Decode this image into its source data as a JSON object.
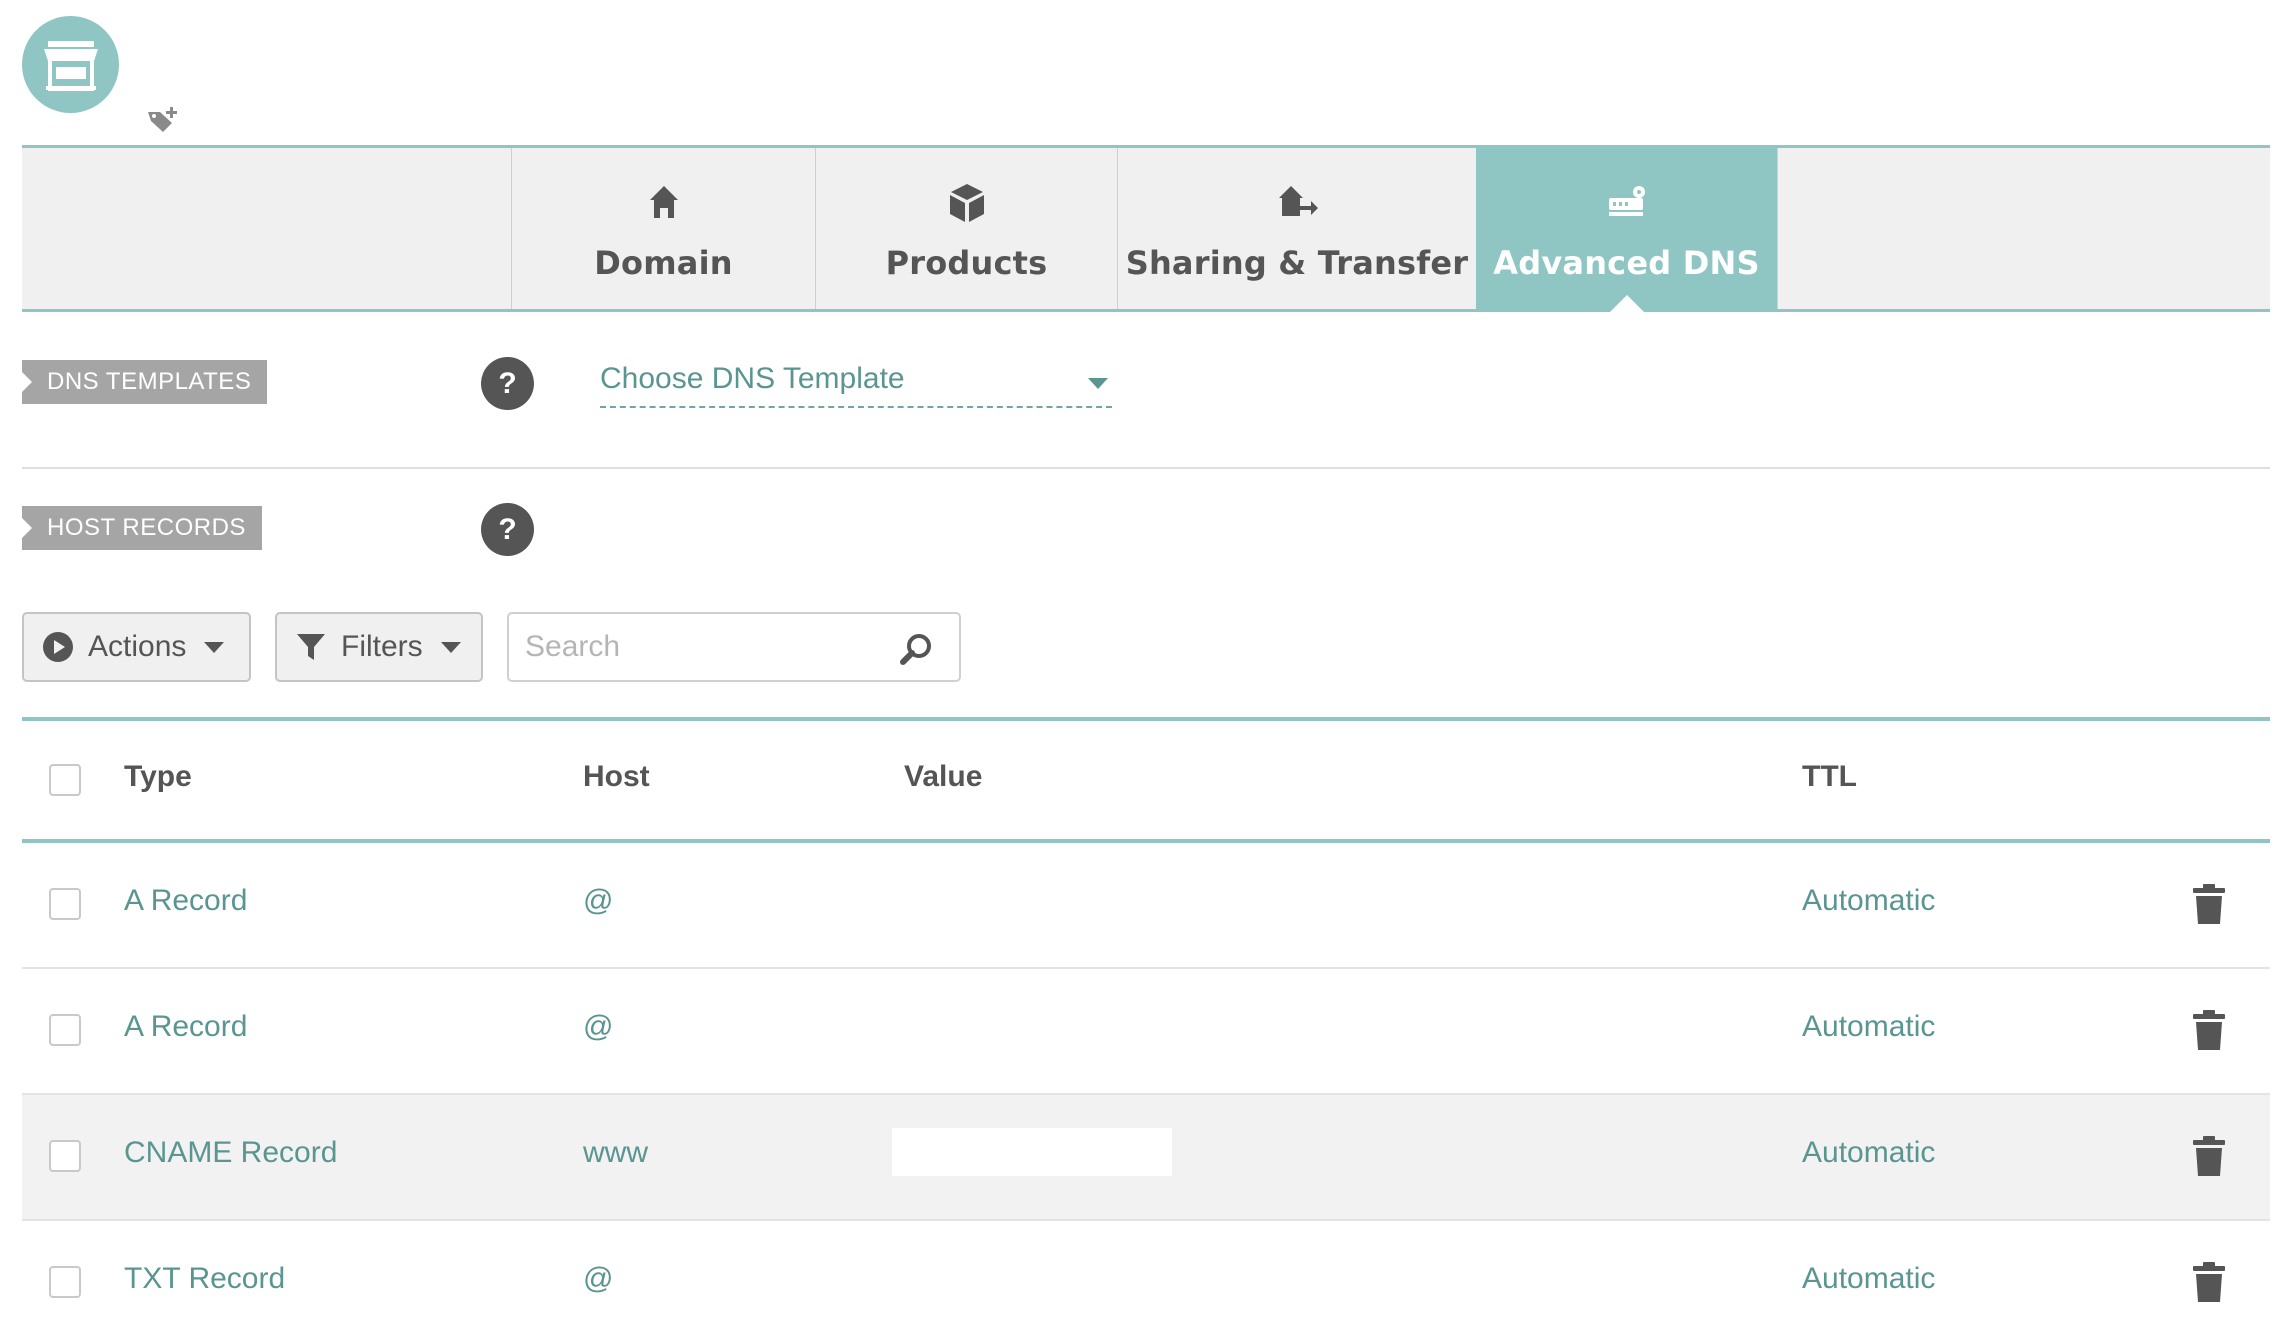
{
  "header": {
    "avatar_icon": "storefront-icon",
    "tag_icon": "tag-add-icon"
  },
  "tabs": [
    {
      "label": "Domain",
      "icon": "home-icon",
      "active": false
    },
    {
      "label": "Products",
      "icon": "box-icon",
      "active": false
    },
    {
      "label": "Sharing & Transfer",
      "icon": "house-transfer-icon",
      "active": false
    },
    {
      "label": "Advanced DNS",
      "icon": "router-icon",
      "active": true
    }
  ],
  "dns_templates": {
    "label": "DNS TEMPLATES",
    "help": "?",
    "select_value": "Choose DNS Template"
  },
  "host_records": {
    "label": "HOST RECORDS",
    "help": "?"
  },
  "toolbar": {
    "actions_label": "Actions",
    "filters_label": "Filters",
    "search_placeholder": "Search"
  },
  "table": {
    "columns": {
      "type": "Type",
      "host": "Host",
      "value": "Value",
      "ttl": "TTL"
    },
    "rows": [
      {
        "type": "A Record",
        "host": "@",
        "value": "",
        "ttl": "Automatic"
      },
      {
        "type": "A Record",
        "host": "@",
        "value": "",
        "ttl": "Automatic"
      },
      {
        "type": "CNAME Record",
        "host": "www",
        "value": "",
        "ttl": "Automatic"
      },
      {
        "type": "TXT Record",
        "host": "@",
        "value": "",
        "ttl": "Automatic"
      }
    ]
  },
  "colors": {
    "accent": "#8fc6c3",
    "link": "#5a9591",
    "label_bg": "#a5a5a5",
    "help_bg": "#555555"
  }
}
